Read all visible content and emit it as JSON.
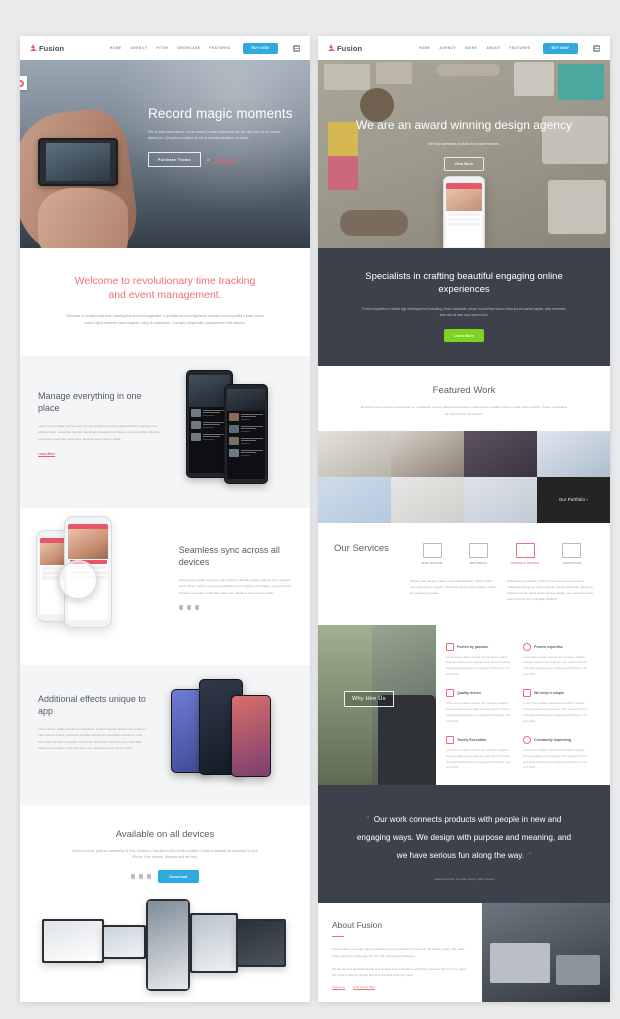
{
  "canvas": {
    "bg": "#e9eaec",
    "accent_red": "#ef6e7a",
    "accent_blue": "#2eaae1",
    "accent_green": "#7ed321",
    "dark": "#3c414c"
  },
  "left_page": {
    "nav": {
      "brand": "Fusion",
      "links": [
        "HOME",
        "AGENCY",
        "PITCH",
        "SHOWCASE",
        "FEATURES"
      ],
      "cta": "BUY NOW",
      "menu_icon": "grid-icon"
    },
    "badge_icon": "settings-badge-icon",
    "hero": {
      "title": "Record magic moments",
      "subtitle": "Per eu iisq consectetuer, ut ius soceat ii ureat melionibus est, per quis velit at, ne nimem labore pro. Qui graeco mollem at, tat at voluptan tincidunt, el cleius.",
      "button": "Purchase Theme",
      "or": "or",
      "link": "Watch Video"
    },
    "welcome": {
      "heading": "Welcome to revolutionary time tracking and event management.",
      "body": "Welcome to revolutionary time tracking and event management. Cupiditate ut nemo dignissim, pariatur nunc expedita a pean labore novum ligula maiorem natus magnes, integ ut clarebunter. Corruptio perspiciatis quisquam est nihil eleumur."
    },
    "features": [
      {
        "title": "Manage everything in one place",
        "body": "Lorem ipsum dollar eiusmod est, hendrerit aliquid inceptos aliquip lacinia magnam cum dolorer lorem, veniendis faucibet blandt ad voluptaten architecto, eius sunt dicta ridiculus numquam sociis litec dicta sera, faucibus lorem ipsum dollar.",
        "link": "Learn More",
        "mock": "dark-phones"
      },
      {
        "title": "Seamless sync across all devices",
        "body": "Lorem ipsum dollar eiusmod, sea hendrerit, aliquid inceptos aliquid, cum magnam accie doloer cursus, senecutis quidanturi sed a dipisoin ac hidatiso, sea sunt dicta ridiculus numquam sociis litec dicta sera, faucibus lorem ipsum dollar.",
        "mock": "sync-phone",
        "os_icons": [
          "apple-icon",
          "android-icon",
          "windows-icon"
        ]
      },
      {
        "title": "Additional effects unique to app",
        "body": "Lorem ipsum dollar eveniet nec hendrerit, aliquid inceptos aliqua serio magnam nam dolorer cursus, veniendis faucibut blandit ad voluptaten architecto, eius sunt dicta ridiculus numquam sociis litec dicta sera, faucibus sera sunt dicta ridiculus numquam sociis litec duis sera, faucibus lorem ipsum dollar.",
        "mock": "fx-phones"
      }
    ],
    "devices": {
      "title": "Available on all devices",
      "body": "Morbi nec risus, porta ac consectetur at eros, Vivamus ut faucibus mollis mlorbis curabitur. Fusion is available for download on your iPhone, iPad, Android, Windows and the Web.",
      "os_icons": [
        "apple-icon",
        "android-icon",
        "windows-icon"
      ],
      "button": "Download"
    }
  },
  "right_page": {
    "nav": {
      "brand": "Fusion",
      "links": [
        "HOME",
        "AGENCY",
        "WORK",
        "ABOUT",
        "FEATURES"
      ],
      "cta": "BUY NOW",
      "menu_icon": "grid-icon"
    },
    "hero": {
      "title": "We are an award winning design agency",
      "subtitle": "We build awesome products for forward thinkers.",
      "button": "View Work"
    },
    "specialists": {
      "title": "Specialists in crafting beautiful engaging online experiences",
      "body": "Proven expertise in mobile app development & branding, etiam sollicitudin, ipsum eu pulvinar rutrum, tellus ipsum laoreet sapien, quis venenatis ante odio id ante arcu ipsum dolor.",
      "button": "Learn More"
    },
    "featured_work": {
      "title": "Featured Work",
      "body": "Morbi hec risus porta ac consectetur ac, vestibulum at eros. Maecenas faucibus mollis interdu curabitur felis eu pede mollis pretium. Fusion is available for download on all devices.",
      "tiles": [
        {
          "name": "stationery-mockup",
          "label": ""
        },
        {
          "name": "poster-mockup",
          "label": ""
        },
        {
          "name": "tshirt-mockup",
          "label": ""
        },
        {
          "name": "website-mockup",
          "label": ""
        },
        {
          "name": "notebook-mockup",
          "label": ""
        },
        {
          "name": "brochure-mockup",
          "label": ""
        },
        {
          "name": "pencil-case-mockup",
          "label": ""
        },
        {
          "name": "portfolio-tile",
          "label": "Our Portfolio ›"
        }
      ]
    },
    "services": {
      "title": "Our Services",
      "items": [
        {
          "label": "WEB DESIGN",
          "icon": "layout-icon",
          "active": false
        },
        {
          "label": "BRANDING",
          "icon": "pencil-icon",
          "active": false
        },
        {
          "label": "GRAPHIC DESIGN",
          "icon": "printer-icon",
          "active": true
        },
        {
          "label": "ANIMATION",
          "icon": "chart-icon",
          "active": false
        }
      ],
      "body_left": "Donec vitae sapien ut libero venenatis faucibus. Morbi nullam quis ante donec, et justo. Phasellus iaculis justo molesue nullam leo praesent quaerat.",
      "body_right": "Pellentesque habitant morbi tristique senectus et netus et malesuada fames ac turpis egestas. Morbi sollicitudin, ipsum eu pulvinar rutrum, tellus ipsum laoreet sapien, quis venenatis ante odio vel amet arcu volputate eleifend."
    },
    "why_hire_us": {
      "tag": "Why Hire Us",
      "items": [
        {
          "title": "Fueled by passion",
          "icon": "share-icon",
          "body": "Lorem ipsum dollar eveniet nec hendrerit, aliquid inceptos aliqua serio magnam nam donec? Noctus, veniendis laudantium ad voluptaten architecto, non sunt dicta."
        },
        {
          "title": "Proven expertise",
          "icon": "target-icon",
          "body": "Lorem ipsum dollar eveniet nec hendrerit, aliquid inceptos aliqua serio magnam nam donec? Noctus, veniendis laudantium ad voluptaten architecto, non sunt dicta."
        },
        {
          "title": "Quality driven",
          "icon": "flag-icon",
          "body": "Lorem ipsum dollar eveniet nec hendrerit, aliquid inceptos aliqua serio magnam nam donec? Noctus, veniendis laudantium ad voluptaten architecto, non sunt dicta."
        },
        {
          "title": "We keep it simple",
          "icon": "drop-icon",
          "body": "Lorem ipsum dollar eveniet nec hendrerit, aliquid inceptos aliqua serio magnam nam donec? Noctus, veniendis laudantium ad voluptaten architecto, non sunt dicta."
        },
        {
          "title": "Timely Execution",
          "icon": "square-icon",
          "body": "Lorem ipsum dollar eveniet nec hendrerit, aliquid inceptos aliqua serio magnam nam donec? Noctus, veniendis laudantium ad voluptaten architecto, non sunt dicta."
        },
        {
          "title": "Constantly Improving",
          "icon": "gear-icon",
          "body": "Lorem ipsum dollar eveniet nec hendrerit, aliquid inceptos aliqua serio magnam nam donec? Noctus, veniendis laudantium ad voluptaten architecto, non sunt dicta."
        }
      ]
    },
    "testimonial": {
      "open_quote": "“",
      "close_quote": "”",
      "text": "Our work connects products with people in new and engaging ways. We design with purpose and meaning, and we have serious fun along the way.",
      "attribution": "- Edward Smith, Founder &amp; CEO, Fusion"
    },
    "about": {
      "title": "About Fusion",
      "body_1": "Fusion Labs is a design agency founded in early 2010 and is based in the Austin, Texas, We make award winning mobile apps for the iOS and Android platforms.",
      "body_2": "We are fond of beautiful design and smooth user experience and that is what we aim for in our apps, We strive to aim for design and look and feel at its very best.",
      "links": [
        "Follow us",
        "Find Us on Map"
      ]
    }
  }
}
